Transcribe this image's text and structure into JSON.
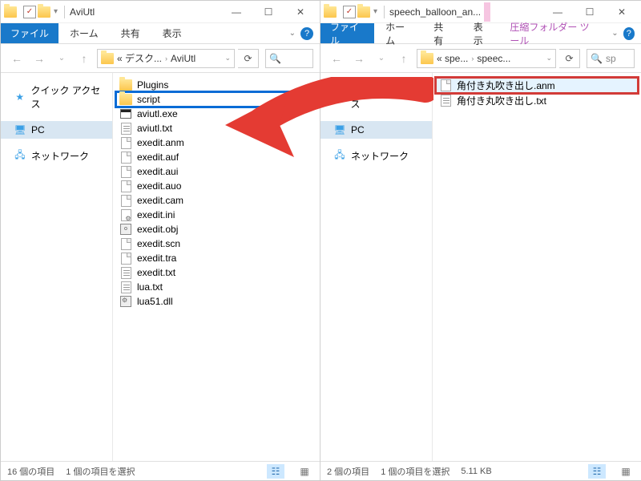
{
  "left": {
    "title": "AviUtl",
    "tabs": {
      "file": "ファイル",
      "home": "ホーム",
      "share": "共有",
      "view": "表示"
    },
    "breadcrumb": {
      "prefix": "« デスク...",
      "current": "AviUtl"
    },
    "nav": {
      "quick": "クイック アクセス",
      "pc": "PC",
      "network": "ネットワーク"
    },
    "files": [
      {
        "name": "Plugins",
        "type": "folder"
      },
      {
        "name": "script",
        "type": "folder",
        "highlight": "blue"
      },
      {
        "name": "aviutl.exe",
        "type": "exe"
      },
      {
        "name": "aviutl.txt",
        "type": "txt"
      },
      {
        "name": "exedit.anm",
        "type": "doc"
      },
      {
        "name": "exedit.auf",
        "type": "doc"
      },
      {
        "name": "exedit.aui",
        "type": "doc"
      },
      {
        "name": "exedit.auo",
        "type": "doc"
      },
      {
        "name": "exedit.cam",
        "type": "doc"
      },
      {
        "name": "exedit.ini",
        "type": "ini"
      },
      {
        "name": "exedit.obj",
        "type": "obj"
      },
      {
        "name": "exedit.scn",
        "type": "doc"
      },
      {
        "name": "exedit.tra",
        "type": "doc"
      },
      {
        "name": "exedit.txt",
        "type": "txt"
      },
      {
        "name": "lua.txt",
        "type": "txt"
      },
      {
        "name": "lua51.dll",
        "type": "dll"
      }
    ],
    "status": {
      "count": "16 個の項目",
      "selected": "1 個の項目を選択"
    }
  },
  "right": {
    "title": "speech_balloon_an...",
    "tabs": {
      "file": "ファイル",
      "home": "ホーム",
      "share": "共有",
      "view": "表示",
      "extra": "圧縮フォルダー ツール"
    },
    "breadcrumb": {
      "prefix": "« spe...",
      "current": "speec..."
    },
    "search_placeholder": "sp",
    "nav": {
      "quick": "クイック アクセス",
      "pc": "PC",
      "network": "ネットワーク"
    },
    "files": [
      {
        "name": "角付き丸吹き出し.anm",
        "type": "doc",
        "highlight": "red"
      },
      {
        "name": "角付き丸吹き出し.txt",
        "type": "txt"
      }
    ],
    "status": {
      "count": "2 個の項目",
      "selected": "1 個の項目を選択",
      "size": "5.11 KB"
    }
  }
}
